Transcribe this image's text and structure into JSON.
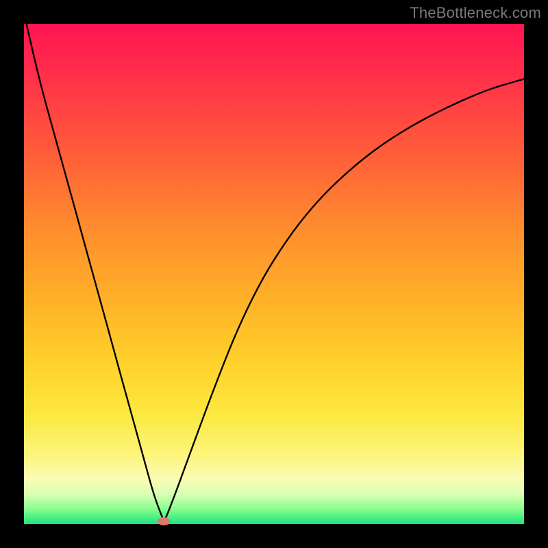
{
  "watermark": "TheBottleneck.com",
  "chart_data": {
    "type": "line",
    "title": "",
    "xlabel": "",
    "ylabel": "",
    "xlim": [
      0,
      100
    ],
    "ylim": [
      0,
      100
    ],
    "grid": false,
    "legend": false,
    "min_point": {
      "x": 28,
      "y": 0.6
    },
    "min_marker_color": "#de7870",
    "series": [
      {
        "name": "bottleneck-curve",
        "color": "#000000",
        "x": [
          0.5,
          3,
          6,
          9,
          12,
          15,
          18,
          21,
          24,
          26,
          27.5,
          28,
          28.5,
          30,
          32,
          35,
          38,
          42,
          46,
          50,
          55,
          60,
          66,
          72,
          79,
          86,
          93,
          100
        ],
        "y": [
          100,
          89.1,
          78.2,
          67.3,
          56.5,
          45.6,
          34.7,
          23.8,
          12.9,
          5.7,
          1.7,
          0.6,
          1.5,
          5.4,
          10.8,
          19.0,
          27.1,
          37.3,
          45.9,
          53.0,
          60.2,
          66.0,
          71.6,
          76.2,
          80.5,
          84.0,
          87.0,
          89.0
        ]
      }
    ],
    "background_gradient": {
      "top": "#ff1452",
      "mid": "#ffd22a",
      "bottom": "#1fe27e"
    },
    "annotations": []
  }
}
